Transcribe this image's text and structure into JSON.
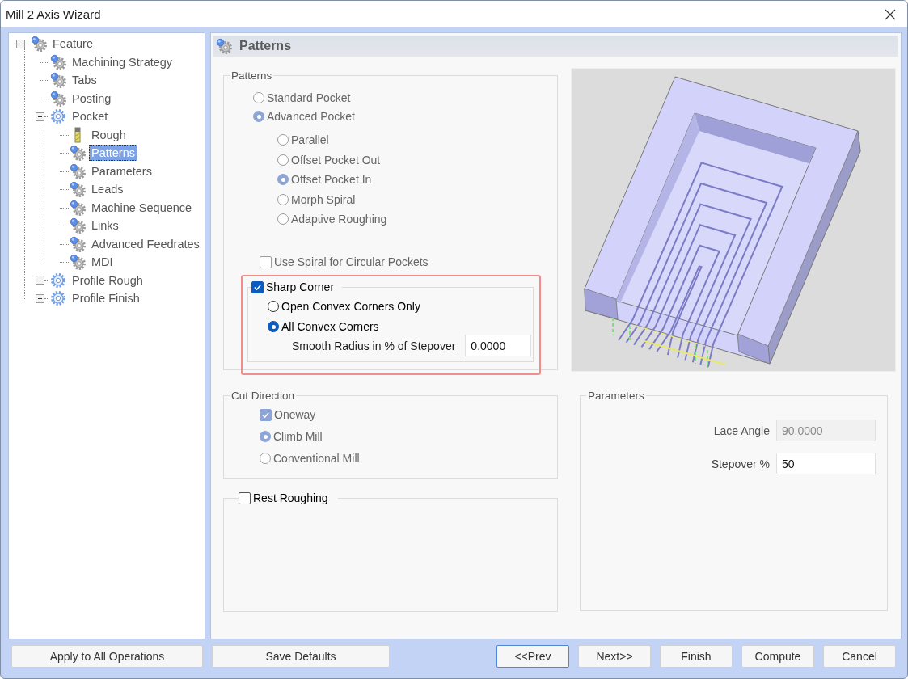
{
  "window": {
    "title": "Mill 2 Axis Wizard"
  },
  "tree": [
    {
      "label": "Feature",
      "kind": "gear-dot",
      "selected": false,
      "expanded": true,
      "children": [
        {
          "label": "Machining Strategy",
          "kind": "gear-dot",
          "selected": false
        },
        {
          "label": "Tabs",
          "kind": "gear-dot",
          "selected": false
        },
        {
          "label": "Posting",
          "kind": "gear-dot",
          "selected": false
        },
        {
          "label": "Pocket",
          "kind": "gear",
          "selected": false,
          "expanded": true,
          "children": [
            {
              "label": "Rough",
              "kind": "tool",
              "selected": false
            },
            {
              "label": "Patterns",
              "kind": "gear-dot",
              "selected": true
            },
            {
              "label": "Parameters",
              "kind": "gear-dot",
              "selected": false
            },
            {
              "label": "Leads",
              "kind": "gear-dot",
              "selected": false
            },
            {
              "label": "Machine Sequence",
              "kind": "gear-dot",
              "selected": false
            },
            {
              "label": "Links",
              "kind": "gear-dot",
              "selected": false
            },
            {
              "label": "Advanced Feedrates",
              "kind": "gear-dot",
              "selected": false
            },
            {
              "label": "MDI",
              "kind": "gear-dot",
              "selected": false
            }
          ]
        },
        {
          "label": "Profile Rough",
          "kind": "gear",
          "selected": false,
          "expanded": false
        },
        {
          "label": "Profile Finish",
          "kind": "gear",
          "selected": false,
          "expanded": false
        }
      ]
    }
  ],
  "page_header": "Patterns",
  "patterns_group": {
    "title": "Patterns",
    "pocket_types": [
      {
        "label": "Standard Pocket",
        "selected": false,
        "disabled": true
      },
      {
        "label": "Advanced Pocket",
        "selected": true,
        "disabled": true
      }
    ],
    "pattern_types": [
      {
        "label": "Parallel",
        "selected": false,
        "disabled": true
      },
      {
        "label": "Offset Pocket Out",
        "selected": false,
        "disabled": true
      },
      {
        "label": "Offset Pocket In",
        "selected": true,
        "disabled": true
      },
      {
        "label": "Morph Spiral",
        "selected": false,
        "disabled": true
      },
      {
        "label": "Adaptive Roughing",
        "selected": false,
        "disabled": true
      }
    ],
    "spiral_option": {
      "label": "Use Spiral for Circular Pockets",
      "checked": false,
      "disabled": true
    },
    "sharp_corner": {
      "label": "Sharp Corner",
      "checked": true,
      "highlighted": true,
      "corner_options": [
        {
          "label": "Open Convex Corners Only",
          "selected": false,
          "disabled": false
        },
        {
          "label": "All Convex Corners",
          "selected": true,
          "disabled": false
        }
      ],
      "smooth_radius": {
        "label": "Smooth Radius in % of Stepover",
        "value": "0.0000"
      }
    }
  },
  "cut_direction": {
    "title": "Cut Direction",
    "oneway": {
      "label": "Oneway",
      "checked": true,
      "disabled": true
    },
    "mill_types": [
      {
        "label": "Climb Mill",
        "selected": true,
        "disabled": true
      },
      {
        "label": "Conventional Mill",
        "selected": false,
        "disabled": true
      }
    ]
  },
  "rest_roughing": {
    "label": "Rest Roughing",
    "checked": false,
    "disabled": false
  },
  "parameters": {
    "title": "Parameters",
    "fields": [
      {
        "label": "Lace Angle",
        "value": "90.0000",
        "disabled": true
      },
      {
        "label": "Stepover %",
        "value": "50",
        "disabled": false
      }
    ]
  },
  "left_buttons": [
    {
      "label": "Apply to All Operations",
      "default": false
    },
    {
      "label": "Save Defaults",
      "default": false
    }
  ],
  "right_buttons": [
    {
      "label": "<<Prev",
      "default": true
    },
    {
      "label": "Next>>",
      "default": false
    },
    {
      "label": "Finish",
      "default": false
    },
    {
      "label": "Compute",
      "default": false
    },
    {
      "label": "Cancel",
      "default": false
    }
  ]
}
